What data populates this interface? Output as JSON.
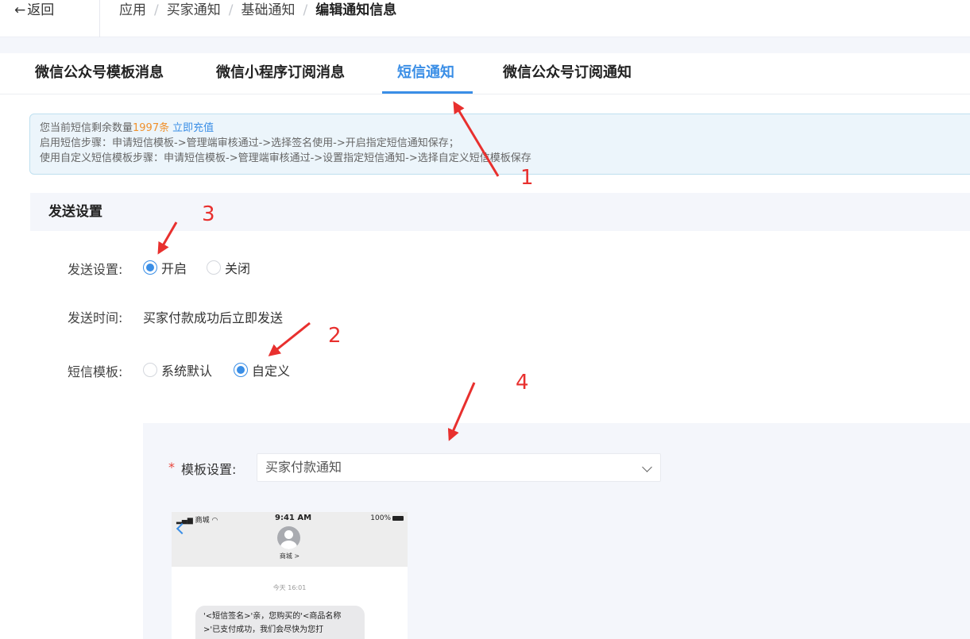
{
  "header": {
    "back_label": "返回",
    "breadcrumb": [
      "应用",
      "买家通知",
      "基础通知",
      "编辑通知信息"
    ]
  },
  "tabs": [
    {
      "label": "微信公众号模板消息",
      "active": false
    },
    {
      "label": "微信小程序订阅消息",
      "active": false
    },
    {
      "label": "短信通知",
      "active": true
    },
    {
      "label": "微信公众号订阅通知",
      "active": false
    }
  ],
  "notice": {
    "remaining_prefix": "您当前短信剩余数量",
    "remaining_count": "1997条",
    "recharge_link": "立即充值",
    "line2": "启用短信步骤：申请短信模板->管理端审核通过->选择签名使用->开启指定短信通知保存；",
    "line3": "使用自定义短信模板步骤：申请短信模板->管理端审核通过->设置指定短信通知->选择自定义短信模板保存"
  },
  "section": {
    "title": "发送设置"
  },
  "form": {
    "send_setting": {
      "label": "发送设置:",
      "options": [
        {
          "label": "开启",
          "selected": true
        },
        {
          "label": "关闭",
          "selected": false
        }
      ]
    },
    "send_time": {
      "label": "发送时间:",
      "value": "买家付款成功后立即发送"
    },
    "sms_template": {
      "label": "短信模板:",
      "options": [
        {
          "label": "系统默认",
          "selected": false
        },
        {
          "label": "自定义",
          "selected": true
        }
      ]
    },
    "template_setting": {
      "required_mark": "*",
      "label": "模板设置:",
      "selected_value": "买家付款通知"
    }
  },
  "phone_preview": {
    "status_left": "商城",
    "status_time": "9:41 AM",
    "status_battery": "100%",
    "contact_name": "商城 >",
    "message_time": "今天 16:01",
    "message_line1": "'<短信签名>'亲，您购买的'<商品名称",
    "message_line2": ">'已支付成功，我们会尽快为您打"
  },
  "annotations": {
    "marker_1": "1",
    "marker_2": "2",
    "marker_3": "3",
    "marker_4": "4",
    "arrow_color": "#e8302e"
  },
  "colors": {
    "accent": "#3a8ee6",
    "count_orange": "#f0912d",
    "required_red": "#e8453c"
  }
}
